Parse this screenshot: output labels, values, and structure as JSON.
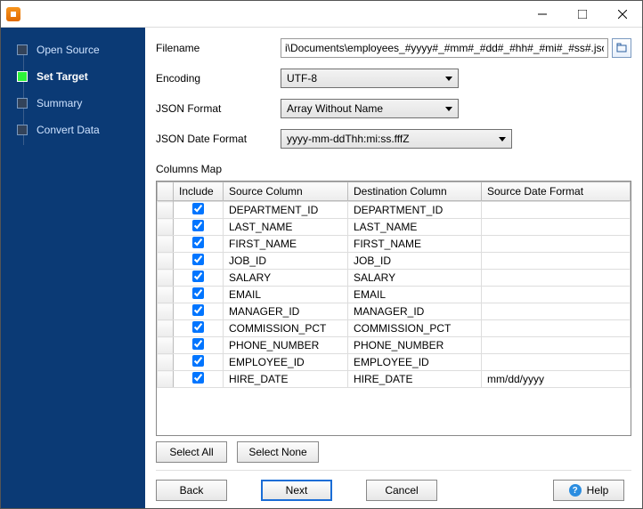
{
  "sidebar": {
    "items": [
      {
        "label": "Open Source"
      },
      {
        "label": "Set Target"
      },
      {
        "label": "Summary"
      },
      {
        "label": "Convert Data"
      }
    ],
    "activeIndex": 1
  },
  "form": {
    "filename_label": "Filename",
    "filename_value": "i\\Documents\\employees_#yyyy#_#mm#_#dd#_#hh#_#mi#_#ss#.json",
    "encoding_label": "Encoding",
    "encoding_value": "UTF-8",
    "json_format_label": "JSON Format",
    "json_format_value": "Array Without Name",
    "json_date_format_label": "JSON Date Format",
    "json_date_format_value": "yyyy-mm-ddThh:mi:ss.fffZ"
  },
  "columns_map_label": "Columns Map",
  "table": {
    "headers": {
      "include": "Include",
      "source": "Source Column",
      "destination": "Destination Column",
      "source_date_format": "Source Date Format"
    },
    "rows": [
      {
        "include": true,
        "source": "DEPARTMENT_ID",
        "destination": "DEPARTMENT_ID",
        "fmt": ""
      },
      {
        "include": true,
        "source": "LAST_NAME",
        "destination": "LAST_NAME",
        "fmt": ""
      },
      {
        "include": true,
        "source": "FIRST_NAME",
        "destination": "FIRST_NAME",
        "fmt": ""
      },
      {
        "include": true,
        "source": "JOB_ID",
        "destination": "JOB_ID",
        "fmt": ""
      },
      {
        "include": true,
        "source": "SALARY",
        "destination": "SALARY",
        "fmt": ""
      },
      {
        "include": true,
        "source": "EMAIL",
        "destination": "EMAIL",
        "fmt": ""
      },
      {
        "include": true,
        "source": "MANAGER_ID",
        "destination": "MANAGER_ID",
        "fmt": ""
      },
      {
        "include": true,
        "source": "COMMISSION_PCT",
        "destination": "COMMISSION_PCT",
        "fmt": ""
      },
      {
        "include": true,
        "source": "PHONE_NUMBER",
        "destination": "PHONE_NUMBER",
        "fmt": ""
      },
      {
        "include": true,
        "source": "EMPLOYEE_ID",
        "destination": "EMPLOYEE_ID",
        "fmt": ""
      },
      {
        "include": true,
        "source": "HIRE_DATE",
        "destination": "HIRE_DATE",
        "fmt": "mm/dd/yyyy"
      }
    ]
  },
  "buttons": {
    "select_all": "Select All",
    "select_none": "Select None",
    "back": "Back",
    "next": "Next",
    "cancel": "Cancel",
    "help": "Help"
  }
}
